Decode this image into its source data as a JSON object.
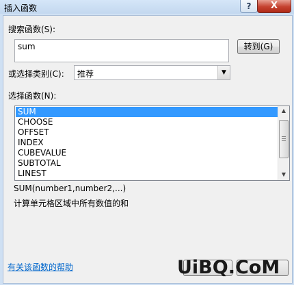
{
  "window": {
    "title": "插入函数",
    "help_button": "?",
    "close_button": "X"
  },
  "search": {
    "label": "搜索函数(S):",
    "value": "sum",
    "goto_button": "转到(G)"
  },
  "category": {
    "label": "或选择类别(C):",
    "value": "推荐",
    "arrow": "▼"
  },
  "functions": {
    "label": "选择函数(N):",
    "items": [
      "SUM",
      "CHOOSE",
      "OFFSET",
      "INDEX",
      "CUBEVALUE",
      "SUBTOTAL",
      "LINEST"
    ],
    "selected": "SUM"
  },
  "details": {
    "signature": "SUM(number1,number2,...)",
    "description": "计算单元格区域中所有数值的和"
  },
  "footer": {
    "help_link": "有关该函数的帮助"
  },
  "watermark": "UiBQ.CoM"
}
